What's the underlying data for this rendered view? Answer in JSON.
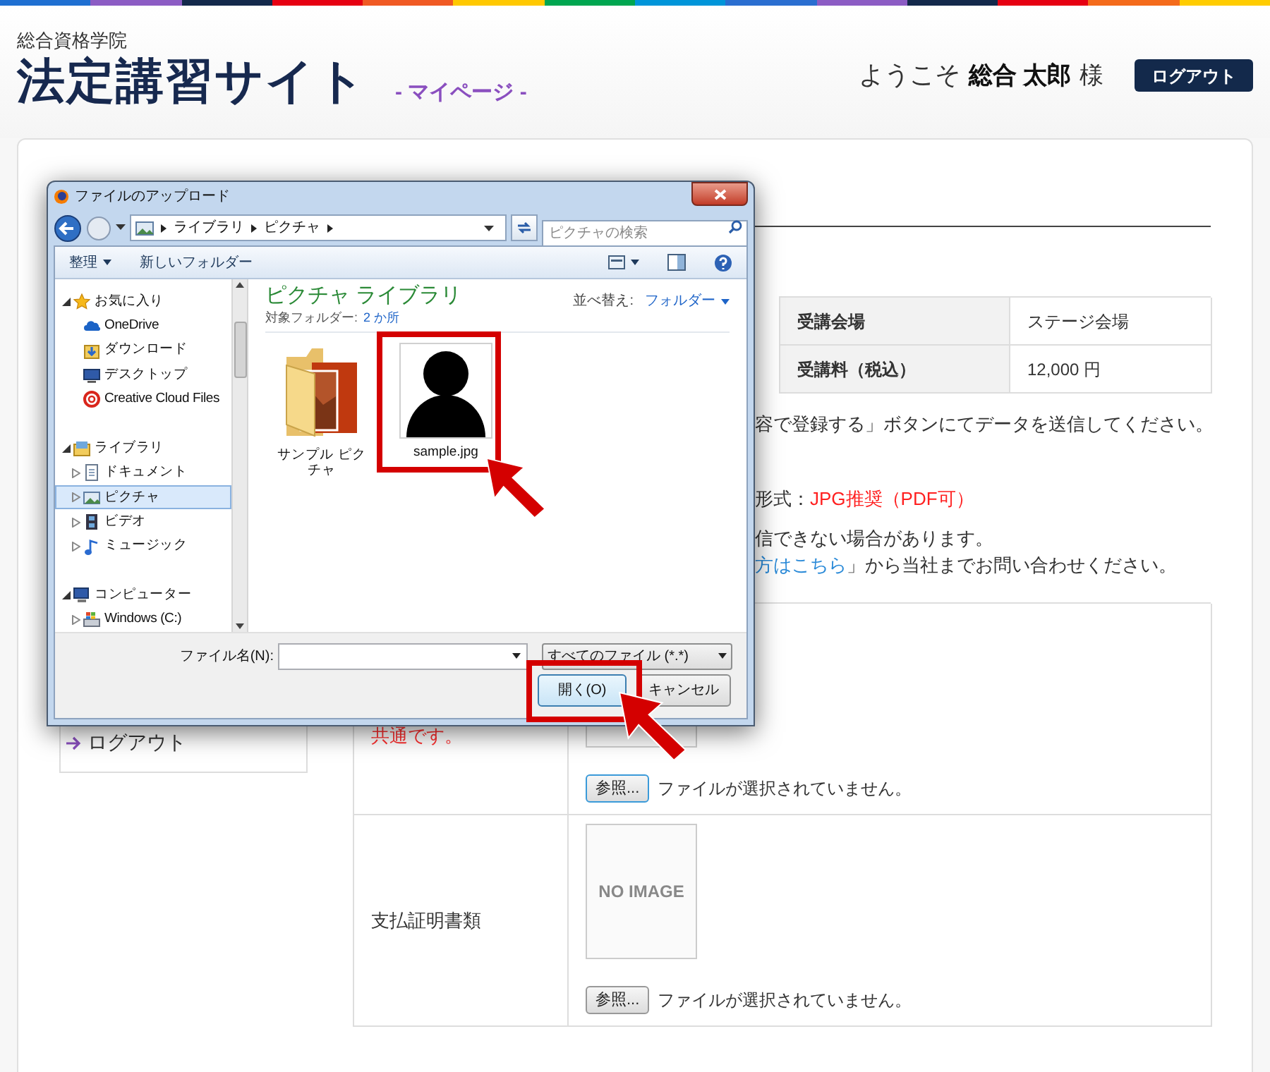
{
  "header": {
    "org": "総合資格学院",
    "title": "法定講習サイト",
    "subtitle": "- マイページ -",
    "welcome": "ようこそ",
    "user_name": "総合 太郎",
    "honorific": "様",
    "logout_button": "ログアウト"
  },
  "info_table": {
    "rows": [
      {
        "label": "受講会場",
        "value": "ステージ会場"
      },
      {
        "label": "受講料（税込）",
        "value": "12,000 円"
      }
    ]
  },
  "notes": [
    {
      "text": "容で登録する」ボタンにてデータを送信してください。"
    },
    {
      "text": "形式：",
      "highlight": "JPG推奨（PDF可）"
    },
    {
      "text": "信できない場合があります。"
    },
    {
      "link": "方はこちら",
      "text": "」から当社までお問い合わせください。"
    }
  ],
  "sidebar": {
    "items": [
      {
        "label": "ログアウト"
      }
    ]
  },
  "upload_table": {
    "rows": [
      {
        "note": "共通です。",
        "browse_button": "参照...",
        "focused": true,
        "file_status": "ファイルが選択されていません。"
      },
      {
        "label": "支払証明書類",
        "preview": "NO IMAGE",
        "browse_button": "参照...",
        "focused": false,
        "file_status": "ファイルが選択されていません。"
      }
    ]
  },
  "dialog": {
    "title": "ファイルのアップロード",
    "breadcrumb": [
      "ライブラリ",
      "ピクチャ"
    ],
    "search_placeholder": "ピクチャの検索",
    "toolbar": {
      "organize": "整理",
      "new_folder": "新しいフォルダー"
    },
    "nav": [
      {
        "label": "お気に入り",
        "kind": "star",
        "expanded": true,
        "selected": false,
        "children": [
          {
            "label": "OneDrive",
            "kind": "cloud",
            "selected": false
          },
          {
            "label": "ダウンロード",
            "kind": "download",
            "selected": false
          },
          {
            "label": "デスクトップ",
            "kind": "desktop",
            "selected": false
          },
          {
            "label": "Creative Cloud Files",
            "kind": "cc",
            "selected": false
          }
        ]
      },
      {
        "label": "ライブラリ",
        "kind": "library",
        "expanded": true,
        "selected": false,
        "children": [
          {
            "label": "ドキュメント",
            "kind": "document",
            "expanded": false,
            "selected": false
          },
          {
            "label": "ピクチャ",
            "kind": "picture",
            "expanded": false,
            "selected": true
          },
          {
            "label": "ビデオ",
            "kind": "video",
            "expanded": false,
            "selected": false
          },
          {
            "label": "ミュージック",
            "kind": "music",
            "expanded": false,
            "selected": false
          }
        ]
      },
      {
        "label": "コンピューター",
        "kind": "computer",
        "expanded": true,
        "selected": false,
        "children": [
          {
            "label": "Windows (C:)",
            "kind": "drive",
            "expanded": false,
            "selected": false
          }
        ]
      }
    ],
    "library_title": "ピクチャ ライブラリ",
    "target_label": "対象フォルダー:",
    "target_link": "2 か所",
    "sort_label": "並べ替え:",
    "sort_value": "フォルダー",
    "files": [
      {
        "name": "サンプル ピクチャ",
        "kind": "folder"
      },
      {
        "name": "sample.jpg",
        "kind": "image"
      }
    ],
    "file_name_label": "ファイル名(N):",
    "file_type": "すべてのファイル (*.*)",
    "open_button": "開く(O)",
    "cancel_button": "キャンセル"
  }
}
